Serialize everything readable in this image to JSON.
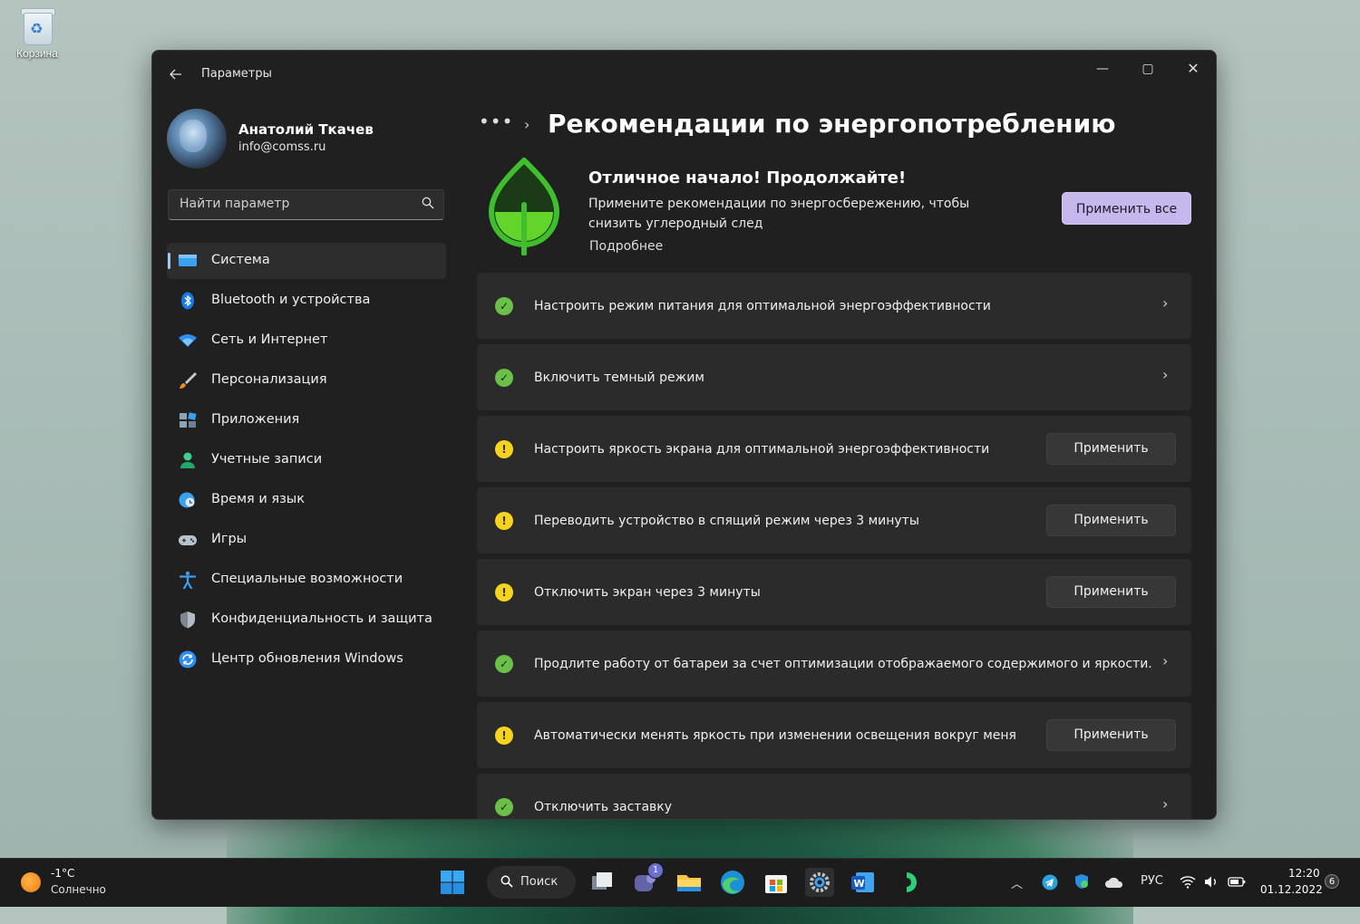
{
  "desktop": {
    "recycle_bin_label": "Корзина"
  },
  "window": {
    "title": "Параметры",
    "controls": {
      "minimize": "—",
      "maximize": "▢",
      "close": "✕"
    }
  },
  "user": {
    "name": "Анатолий Ткачев",
    "email": "info@comss.ru"
  },
  "search": {
    "placeholder": "Найти параметр"
  },
  "sidebar": {
    "items": [
      {
        "label": "Система",
        "icon": "monitor-icon",
        "active": true
      },
      {
        "label": "Bluetooth и устройства",
        "icon": "bluetooth-icon"
      },
      {
        "label": "Сеть и Интернет",
        "icon": "wifi-icon"
      },
      {
        "label": "Персонализация",
        "icon": "brush-icon"
      },
      {
        "label": "Приложения",
        "icon": "apps-icon"
      },
      {
        "label": "Учетные записи",
        "icon": "person-icon"
      },
      {
        "label": "Время и язык",
        "icon": "clock-globe-icon"
      },
      {
        "label": "Игры",
        "icon": "gamepad-icon"
      },
      {
        "label": "Специальные возможности",
        "icon": "accessibility-icon"
      },
      {
        "label": "Конфиденциальность и защита",
        "icon": "shield-icon"
      },
      {
        "label": "Центр обновления Windows",
        "icon": "update-icon"
      }
    ]
  },
  "breadcrumb": {
    "more": "•••",
    "separator": "›"
  },
  "page": {
    "title": "Рекомендации по энергопотреблению"
  },
  "hero": {
    "heading": "Отличное начало! Продолжайте!",
    "description": "Примените рекомендации по энергосбережению, чтобы снизить углеродный след",
    "link": "Подробнее",
    "apply_all": "Применить все"
  },
  "recommendations": [
    {
      "text": "Настроить режим питания для оптимальной энергоэффективности",
      "status": "ok"
    },
    {
      "text": "Включить темный режим",
      "status": "ok"
    },
    {
      "text": "Настроить яркость экрана для оптимальной энергоэффективности",
      "status": "warn",
      "action": "Применить"
    },
    {
      "text": "Переводить устройство в спящий режим через 3 минуты",
      "status": "warn",
      "action": "Применить"
    },
    {
      "text": "Отключить экран через 3 минуты",
      "status": "warn",
      "action": "Применить"
    },
    {
      "text": "Продлите работу от батареи за счет оптимизации отображаемого содержимого и яркости.",
      "status": "ok"
    },
    {
      "text": "Автоматически менять яркость при изменении освещения вокруг меня",
      "status": "warn",
      "action": "Применить"
    },
    {
      "text": "Отключить заставку",
      "status": "ok"
    }
  ],
  "taskbar": {
    "weather": {
      "temp": "-1°C",
      "desc": "Солнечно"
    },
    "search_label": "Поиск",
    "chat_badge": "1",
    "language": "РУС",
    "time": "12:20",
    "date": "01.12.2022",
    "notifications": "6"
  },
  "colors": {
    "accent": "#9cc7ff",
    "apply_all_bg": "#c6b8ec",
    "ok": "#6cc04a",
    "warn": "#f5d31e",
    "window_bg": "#202020",
    "card_bg": "#2b2b2b"
  }
}
